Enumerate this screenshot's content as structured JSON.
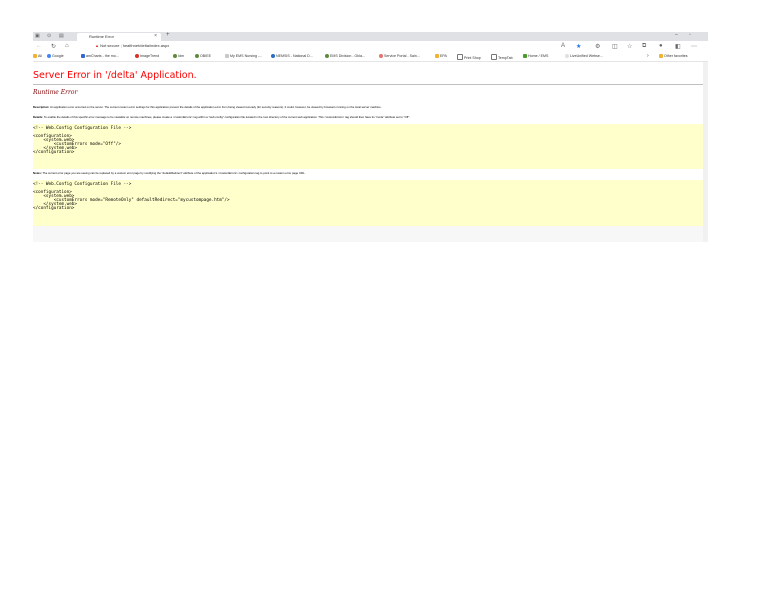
{
  "browser": {
    "tab_title": "Runtime Error",
    "tab_close": "×",
    "new_tab": "+",
    "address": {
      "security": "Not secure",
      "url": "healthnet/delta/index.aspx"
    },
    "favorites": [
      "All",
      "Google",
      "amCharts - the mo...",
      "ImageTrend",
      "Idm",
      "OBIEE",
      "My EMS Nursing -...",
      "NEMSIS - National D...",
      "EMS Division - Okla...",
      "Service Portal - Sain...",
      "EPA",
      "Print Shop",
      "TempTab",
      "Home / EMS",
      "LiveUnified Webse...",
      "Other favorites"
    ],
    "chevron": "›"
  },
  "page": {
    "title": "Server Error in '/delta' Application.",
    "subtitle": "Runtime Error",
    "description_label": "Description:",
    "description_text": "An application error occurred on the server. The current custom error settings for this application prevent the details of the application error from being viewed remotely (for security reasons). It could, however, be viewed by browsers running on the local server machine.",
    "details_label": "Details:",
    "details_text": "To enable the details of this specific error message to be viewable on remote machines, please create a <customErrors> tag within a \"web.config\" configuration file located in the root directory of the current web application. This <customErrors> tag should then have its \"mode\" attribute set to \"Off\".",
    "code1": "<!-- Web.Config Configuration File -->\n\n<configuration>\n    <system.web>\n        <customErrors mode=\"Off\"/>\n    </system.web>\n</configuration>",
    "notes_label": "Notes:",
    "notes_text": "The current error page you are seeing can be replaced by a custom error page by modifying the \"defaultRedirect\" attribute of the application's <customErrors> configuration tag to point to a custom error page URL.",
    "code2": "<!-- Web.Config Configuration File -->\n\n<configuration>\n    <system.web>\n        <customErrors mode=\"RemoteOnly\" defaultRedirect=\"mycustompage.htm\"/>\n    </system.web>\n</configuration>"
  },
  "colors": {
    "error_title": "#ff0000",
    "subtitle": "#800000",
    "code_background": "#ffffcc"
  }
}
